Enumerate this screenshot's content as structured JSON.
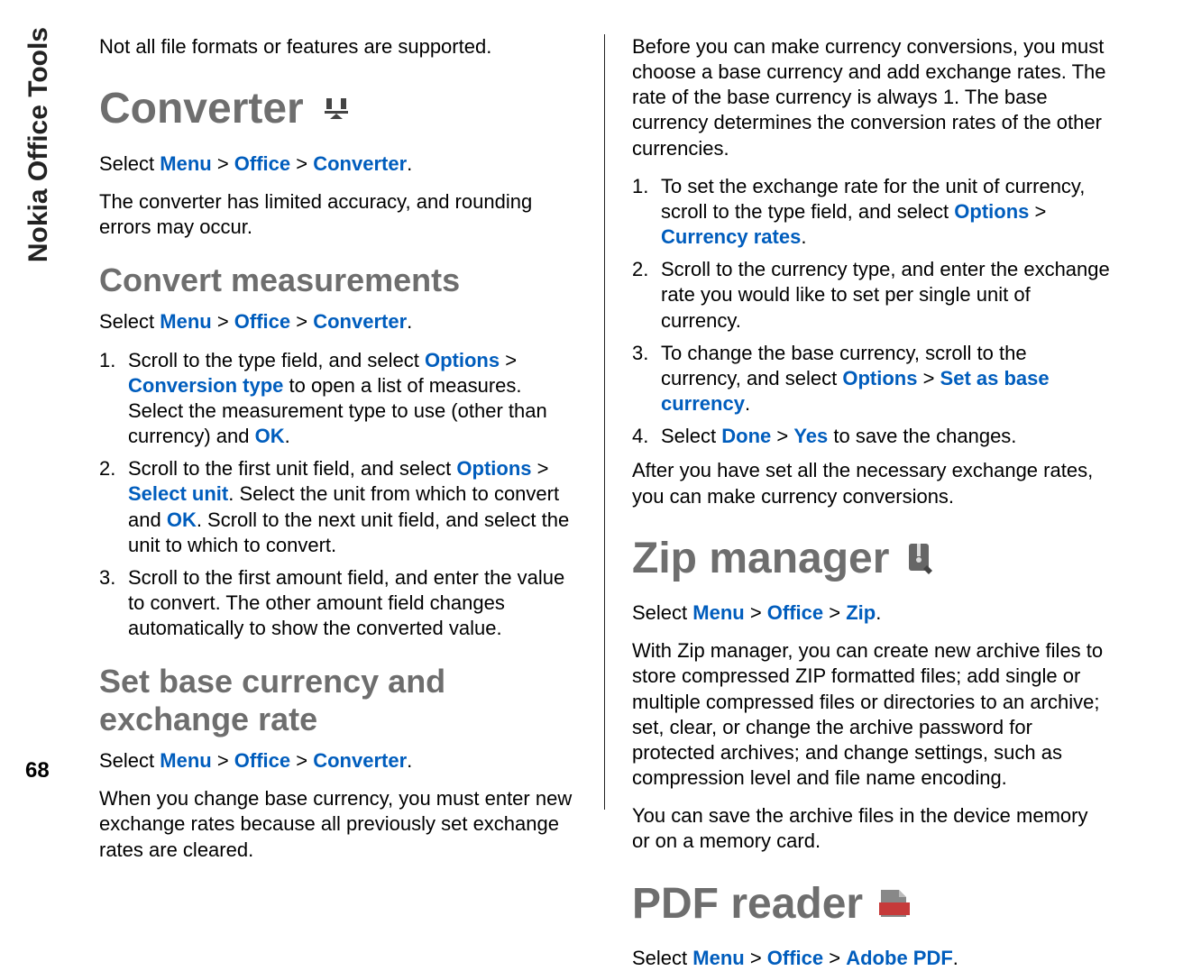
{
  "sidebar_label": "Nokia Office Tools",
  "page_number": "68",
  "left": {
    "intro_note": "Not all file formats or features are supported.",
    "converter": {
      "title": "Converter",
      "select_prefix": "Select ",
      "path": [
        "Menu",
        "Office",
        "Converter"
      ],
      "accuracy": "The converter has limited accuracy, and rounding errors may occur."
    },
    "convert_measurements": {
      "title": "Convert measurements",
      "select_prefix": "Select ",
      "path": [
        "Menu",
        "Office",
        "Converter"
      ],
      "steps": [
        {
          "pre": "Scroll to the type field, and select ",
          "opt": "Options",
          "gt": " > ",
          "conv_type": "Conversion type",
          "mid": " to open a list of measures. Select the measurement type to use (other than currency) and ",
          "ok": "OK",
          "end": "."
        },
        {
          "pre": "Scroll to the first unit field, and select ",
          "opt": "Options",
          "gt": " > ",
          "select_unit": "Select unit",
          "mid": ". Select the unit from which to convert and ",
          "ok": "OK",
          "end": ". Scroll to the next unit field, and select the unit to which to convert."
        },
        {
          "text": "Scroll to the first amount field, and enter the value to convert. The other amount field changes automatically to show the converted value."
        }
      ]
    },
    "set_base": {
      "title": "Set base currency and exchange rate",
      "select_prefix": "Select ",
      "path": [
        "Menu",
        "Office",
        "Converter"
      ],
      "note": "When you change base currency, you must enter new exchange rates because all previously set exchange rates are cleared."
    }
  },
  "right": {
    "intro": "Before you can make currency conversions, you must choose a base currency and add exchange rates. The rate of the base currency is always 1. The base currency determines the conversion rates of the other currencies.",
    "steps": [
      {
        "pre": "To set the exchange rate for the unit of currency, scroll to the type field, and select ",
        "opt": "Options",
        "gt": " > ",
        "link": "Currency rates",
        "end": "."
      },
      {
        "text": "Scroll to the currency type, and enter the exchange rate you would like to set per single unit of currency."
      },
      {
        "pre": "To change the base currency, scroll to the currency, and select ",
        "opt": "Options",
        "gt": " > ",
        "link": "Set as base currency",
        "end": "."
      },
      {
        "pre": "Select ",
        "done": "Done",
        "gt": " > ",
        "yes": "Yes",
        "end": " to save the changes."
      }
    ],
    "after": "After you have set all the necessary exchange rates, you can make currency conversions.",
    "zip": {
      "title": "Zip manager",
      "select_prefix": "Select ",
      "path": [
        "Menu",
        "Office",
        "Zip"
      ],
      "desc": "With Zip manager, you can create new archive files to store compressed ZIP formatted files; add single or multiple compressed files or directories to an archive; set, clear, or change the archive password for protected archives; and change settings, such as compression level and file name encoding.",
      "save": "You can save the archive files in the device memory or on a memory card."
    },
    "pdf": {
      "title": "PDF reader",
      "select_prefix": "Select ",
      "path": [
        "Menu",
        "Office",
        "Adobe PDF"
      ]
    }
  }
}
